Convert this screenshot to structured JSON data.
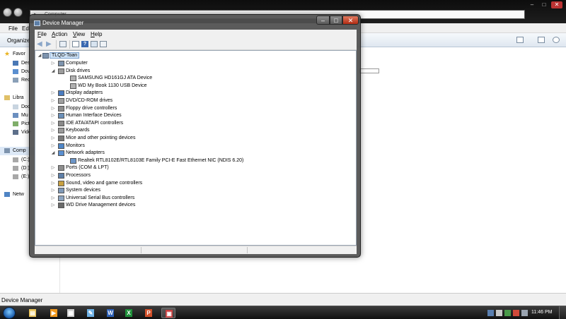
{
  "explorer": {
    "address": "Computer",
    "menus": [
      "File",
      "Edi"
    ],
    "organize_label": "Organize",
    "nav": [
      {
        "label": "Favor",
        "icon": "star-icon"
      },
      {
        "label": "Des",
        "icon": "desktop-icon"
      },
      {
        "label": "Dov",
        "icon": "downloads-icon"
      },
      {
        "label": "Rec",
        "icon": "recent-places-icon"
      },
      {
        "label": "Libra",
        "icon": "libraries-icon"
      },
      {
        "label": "Doc",
        "icon": "documents-icon"
      },
      {
        "label": "Mu",
        "icon": "music-icon"
      },
      {
        "label": "Pict",
        "icon": "pictures-icon"
      },
      {
        "label": "Vide",
        "icon": "videos-icon"
      },
      {
        "label": "Comp",
        "icon": "computer-icon"
      },
      {
        "label": "(C:)",
        "icon": "drive-icon"
      },
      {
        "label": "(D:)",
        "icon": "drive-icon"
      },
      {
        "label": "(E:)",
        "icon": "drive-icon"
      },
      {
        "label": "Netw",
        "icon": "network-icon"
      }
    ],
    "status_text": "Device Manager"
  },
  "device_manager": {
    "title": "Device Manager",
    "window_controls": {
      "minimize": "–",
      "maximize": "□",
      "close": "✕"
    },
    "menus": [
      {
        "key": "F",
        "rest": "ile"
      },
      {
        "key": "A",
        "rest": "ction"
      },
      {
        "key": "V",
        "rest": "iew"
      },
      {
        "key": "H",
        "rest": "elp"
      }
    ],
    "tree": {
      "root": "TLQD-Toan",
      "items": [
        {
          "label": "Computer",
          "level": 1,
          "expanded": false
        },
        {
          "label": "Disk drives",
          "level": 1,
          "expanded": true
        },
        {
          "label": "SAMSUNG HD161GJ ATA Device",
          "level": 2
        },
        {
          "label": "WD My Book 1130 USB Device",
          "level": 2
        },
        {
          "label": "Display adapters",
          "level": 1,
          "expanded": false
        },
        {
          "label": "DVD/CD-ROM drives",
          "level": 1,
          "expanded": false
        },
        {
          "label": "Floppy drive controllers",
          "level": 1,
          "expanded": false
        },
        {
          "label": "Human Interface Devices",
          "level": 1,
          "expanded": false
        },
        {
          "label": "IDE ATA/ATAPI controllers",
          "level": 1,
          "expanded": false
        },
        {
          "label": "Keyboards",
          "level": 1,
          "expanded": false
        },
        {
          "label": "Mice and other pointing devices",
          "level": 1,
          "expanded": false
        },
        {
          "label": "Monitors",
          "level": 1,
          "expanded": false
        },
        {
          "label": "Network adapters",
          "level": 1,
          "expanded": true
        },
        {
          "label": "Realtek RTL8102E/RTL8103E Family PCI-E Fast Ethernet NIC (NDIS 6.20)",
          "level": 2
        },
        {
          "label": "Ports (COM & LPT)",
          "level": 1,
          "expanded": false
        },
        {
          "label": "Processors",
          "level": 1,
          "expanded": false
        },
        {
          "label": "Sound, video and game controllers",
          "level": 1,
          "expanded": false
        },
        {
          "label": "System devices",
          "level": 1,
          "expanded": false
        },
        {
          "label": "Universal Serial Bus controllers",
          "level": 1,
          "expanded": false
        },
        {
          "label": "WD Drive Management devices",
          "level": 1,
          "expanded": false
        }
      ]
    }
  },
  "taskbar": {
    "clock": "11:46 PM",
    "apps": [
      {
        "name": "windows-explorer",
        "glyph": "▤",
        "color": "#e8c25a"
      },
      {
        "name": "media-player",
        "glyph": "▶",
        "color": "#f39a1e"
      },
      {
        "name": "movie-maker",
        "glyph": "▦",
        "color": "#cfcfcf"
      },
      {
        "name": "paint",
        "glyph": "✎",
        "color": "#6fb2e6"
      },
      {
        "name": "word",
        "glyph": "W",
        "color": "#2f62b8"
      },
      {
        "name": "excel",
        "glyph": "X",
        "color": "#1f8f3a"
      },
      {
        "name": "powerpoint",
        "glyph": "P",
        "color": "#d2502a"
      },
      {
        "name": "device-manager",
        "glyph": "▣",
        "color": "#c94040"
      }
    ]
  },
  "colors": {
    "selection": "#cfe3f7",
    "taskbar": "#111111",
    "window_frame": "#505050"
  }
}
